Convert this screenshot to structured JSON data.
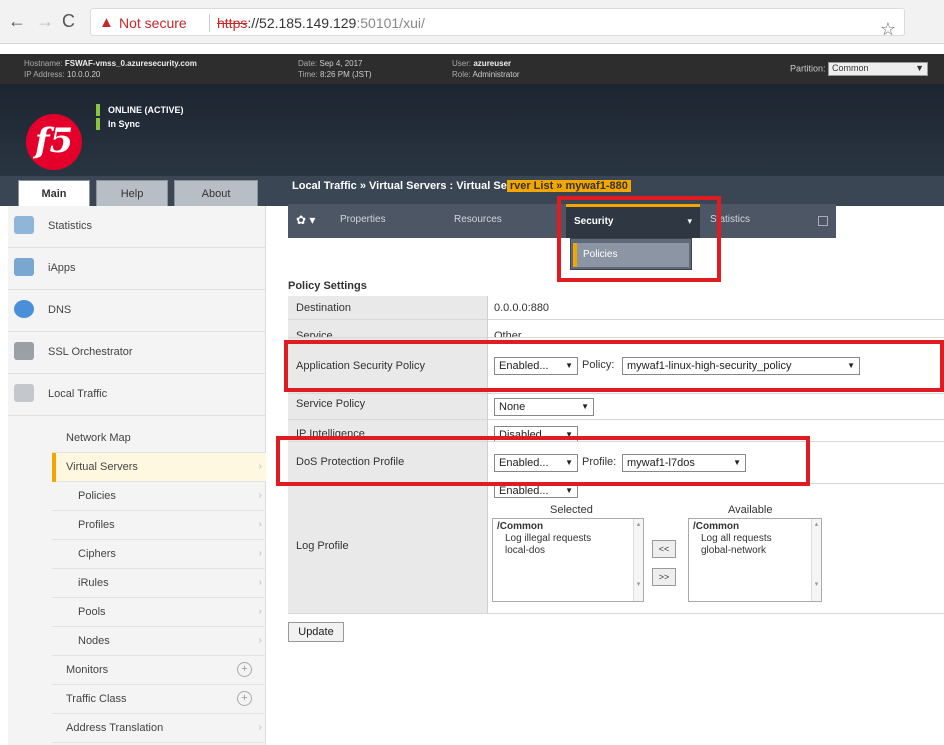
{
  "browser": {
    "warning": "Not secure",
    "url_scheme": "https",
    "url_host": "://52.185.149.129",
    "url_rest": ":50101/xui/"
  },
  "header": {
    "hostname_label": "Hostname:",
    "hostname": "FSWAF-vmss_0.azuresecurity.com",
    "ip_label": "IP Address:",
    "ip": "10.0.0.20",
    "date_label": "Date:",
    "date": "Sep 4, 2017",
    "time_label": "Time:",
    "time": "8:26 PM (JST)",
    "user_label": "User:",
    "user": "azureuser",
    "role_label": "Role:",
    "role": "Administrator",
    "partition_label": "Partition:",
    "partition": "Common"
  },
  "status": {
    "online": "ONLINE (ACTIVE)",
    "sync": "In Sync"
  },
  "logo_text": "f5",
  "tabs": [
    "Main",
    "Help",
    "About"
  ],
  "breadcrumb": {
    "section": "Local Traffic",
    "sep": "»",
    "page": "Virtual Servers : Virtual Se",
    "hidden": "rver List » mywaf1-880"
  },
  "sidebar": {
    "main": [
      "Statistics",
      "iApps",
      "DNS",
      "SSL Orchestrator",
      "Local Traffic"
    ],
    "sub": [
      "Network Map",
      "Virtual Servers",
      "Policies",
      "Profiles",
      "Ciphers",
      "iRules",
      "Pools",
      "Nodes",
      "Monitors",
      "Traffic Class",
      "Address Translation"
    ]
  },
  "content_tabs": {
    "properties": "Properties",
    "resources": "Resources",
    "security": "Security",
    "statistics": "Statistics",
    "dropdown_item": "Policies"
  },
  "policy": {
    "title": "Policy Settings",
    "destination_label": "Destination",
    "destination": "0.0.0.0:880",
    "service_label": "Service",
    "service": "Other",
    "asp_label": "Application Security Policy",
    "asp_state": "Enabled...",
    "asp_policy_label": "Policy:",
    "asp_policy": "mywaf1-linux-high-security_policy",
    "service_policy_label": "Service Policy",
    "service_policy": "None",
    "ip_intel_label": "IP Intelligence",
    "ip_intel": "Disabled",
    "dos_label": "DoS Protection Profile",
    "dos_state": "Enabled...",
    "dos_profile_label": "Profile:",
    "dos_profile": "mywaf1-l7dos",
    "log_label": "Log Profile",
    "log_state": "Enabled...",
    "selected_label": "Selected",
    "available_label": "Available",
    "selected_items": [
      "/Common",
      "Log illegal requests",
      "local-dos"
    ],
    "available_items": [
      "/Common",
      "Log all requests",
      "global-network"
    ],
    "move_left": "<<",
    "move_right": ">>",
    "update": "Update"
  }
}
